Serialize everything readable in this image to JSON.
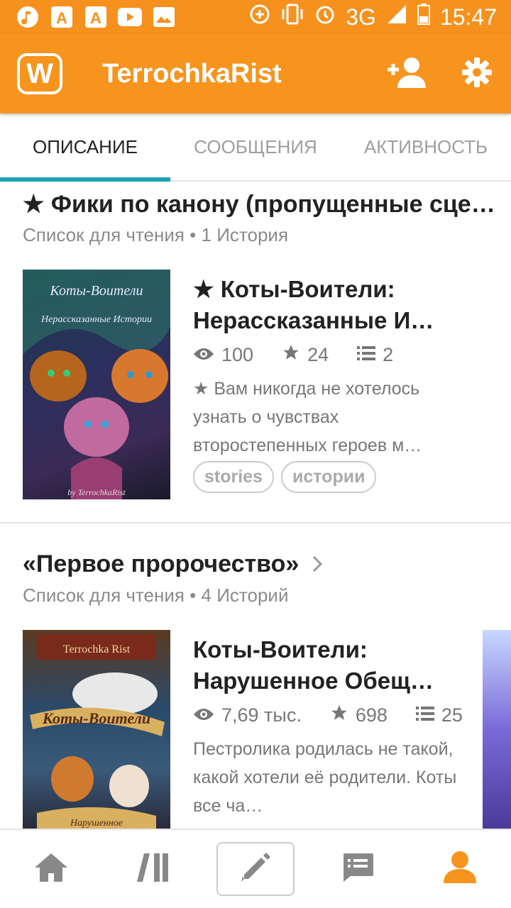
{
  "status": {
    "network": "3G",
    "time": "15:47"
  },
  "app": {
    "logo": "W",
    "title": "TerrochkaRist"
  },
  "tabs": [
    "ОПИСАНИЕ",
    "СООБЩЕНИЯ",
    "АКТИВНОСТЬ"
  ],
  "lists": [
    {
      "title": "★ Фики по канону (пропущенные сце…",
      "subtitle": "Список для чтения • 1 История",
      "story": {
        "cover_text_top": "Коты-Воители",
        "cover_text_sub": "Нерассказанные Истории",
        "cover_text_bottom": "by TerrochkaRist",
        "title": "★ Коты-Воители: Нерассказанные И…",
        "views": "100",
        "votes": "24",
        "parts": "2",
        "description": "★ Вам никогда не хотелось узнать о чувствах второстепенных героев м…",
        "tags": [
          "stories",
          "истории"
        ]
      }
    },
    {
      "title": "«Первое пророчество»",
      "subtitle": "Список для чтения • 4 Историй",
      "story": {
        "cover_text_top": "Terrochka Rist",
        "cover_text_sub": "Коты-Воители",
        "cover_text_bottom": "Нарушенное",
        "title": "Коты-Воители: Нарушенное Обещ…",
        "views": "7,69 тыс.",
        "votes": "698",
        "parts": "25",
        "description": "Пестролика родилась не такой, какой хотели её родители. Коты все ча…"
      }
    }
  ],
  "colors": {
    "brand": "#f7941e",
    "tab_indicator": "#1ba0b4"
  }
}
